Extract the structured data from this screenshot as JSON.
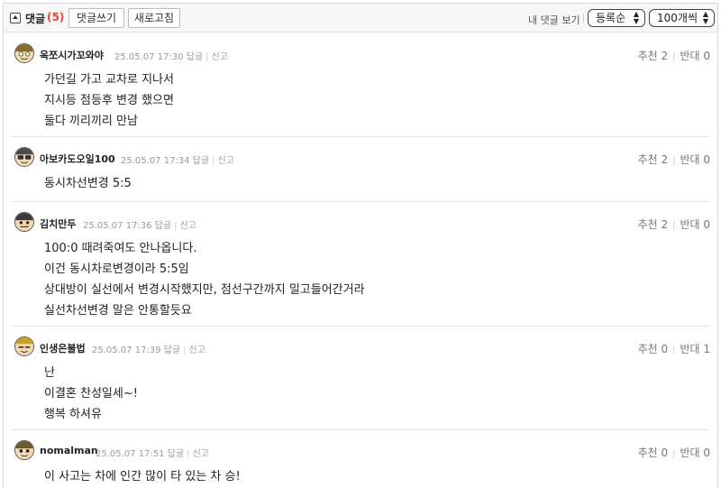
{
  "toolbar": {
    "title": "댓글",
    "count": "(5)",
    "write_label": "댓글쓰기",
    "refresh_label": "새로고침",
    "my_comments_label": "내 댓글 보기",
    "sort_selected": "등록순",
    "page_size_selected": "100개씩"
  },
  "labels": {
    "reply": "답글",
    "report": "신고"
  },
  "comments": [
    {
      "author": "옥쪼시가꼬와야",
      "datetime": "25.05.07 17:30",
      "recommend": "추천 2",
      "oppose": "반대 0",
      "lines": [
        "가던길 가고 교차로 지나서",
        "지시등 점등후 변경 했으면",
        "둘다 끼리끼리 만남"
      ]
    },
    {
      "author": "아보카도오일100",
      "datetime": "25.05.07 17:34",
      "recommend": "추천 2",
      "oppose": "반대 0",
      "lines": [
        "동시차선변경 5:5"
      ]
    },
    {
      "author": "김치만두",
      "datetime": "25.05.07 17:36",
      "recommend": "추천 2",
      "oppose": "반대 0",
      "lines": [
        "100:0 때려죽여도 안나옵니다.",
        "이건 동시차로변경이라 5:5임",
        "상대방이 실선에서 변경시작했지만, 점선구간까지 밀고들어간거라",
        "실선차선변경 말은 안통할듯요"
      ]
    },
    {
      "author": "인생은불법",
      "datetime": "25.05.07 17:39",
      "recommend": "추천 0",
      "oppose": "반대 1",
      "lines": [
        "난",
        "이결혼 찬성일세~!",
        "행복 하셔유"
      ]
    },
    {
      "author": "nomalman",
      "datetime": "25.05.07 17:51",
      "recommend": "추천 0",
      "oppose": "반대 0",
      "lines": [
        "이 사고는 차에 인간 많이 타 있는 차 승!"
      ]
    }
  ],
  "colors": {
    "count_accent": "#e8452c",
    "meta_text": "#9a9a9a",
    "toolbar_bg": "#f7f7f7"
  },
  "icons": {
    "toggle": "collapse-toggle-icon",
    "select_arrow": "up-down-arrow-icon",
    "avatar": "cartoon-avatar-icon"
  }
}
